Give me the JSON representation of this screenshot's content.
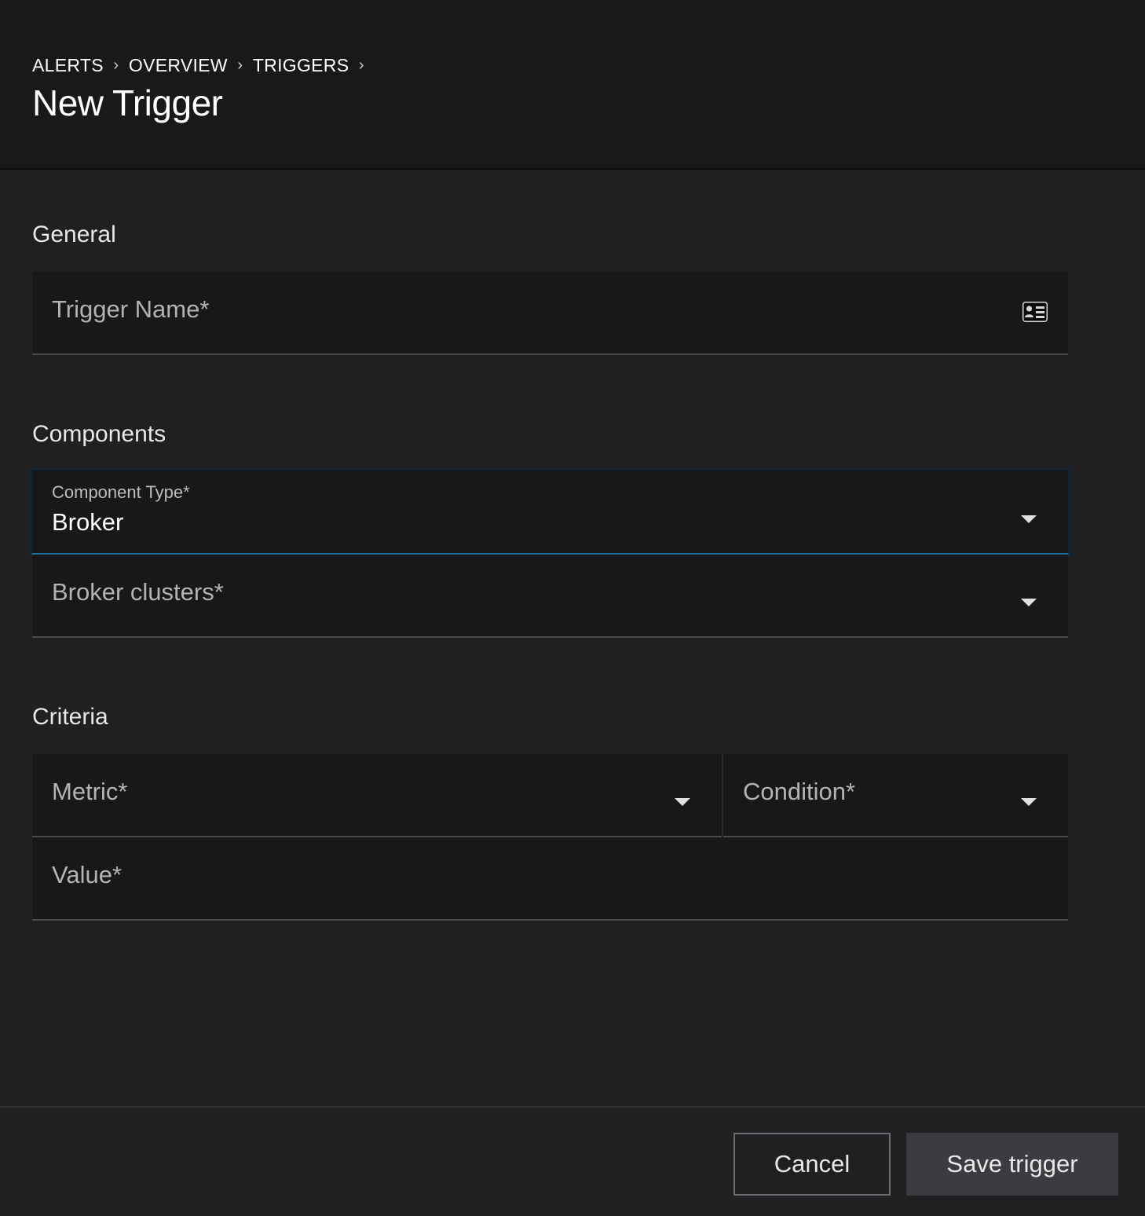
{
  "breadcrumb": {
    "items": [
      "ALERTS",
      "OVERVIEW",
      "TRIGGERS"
    ],
    "separator": "›"
  },
  "page": {
    "title": "New Trigger"
  },
  "general": {
    "title": "General",
    "trigger_name": {
      "placeholder": "Trigger Name*",
      "value": "",
      "icon": "contact-card-icon"
    }
  },
  "components": {
    "title": "Components",
    "component_type": {
      "label": "Component Type*",
      "value": "Broker"
    },
    "broker_clusters": {
      "placeholder": "Broker clusters*"
    }
  },
  "criteria": {
    "title": "Criteria",
    "metric": {
      "placeholder": "Metric*"
    },
    "condition": {
      "placeholder": "Condition*"
    },
    "value": {
      "placeholder": "Value*"
    }
  },
  "footer": {
    "cancel_label": "Cancel",
    "save_label": "Save trigger"
  },
  "colors": {
    "background": "#202023",
    "header": "#19191b",
    "field": "#18181a",
    "focus_accent": "#1f6f9c",
    "save_button": "#3b3b40"
  }
}
